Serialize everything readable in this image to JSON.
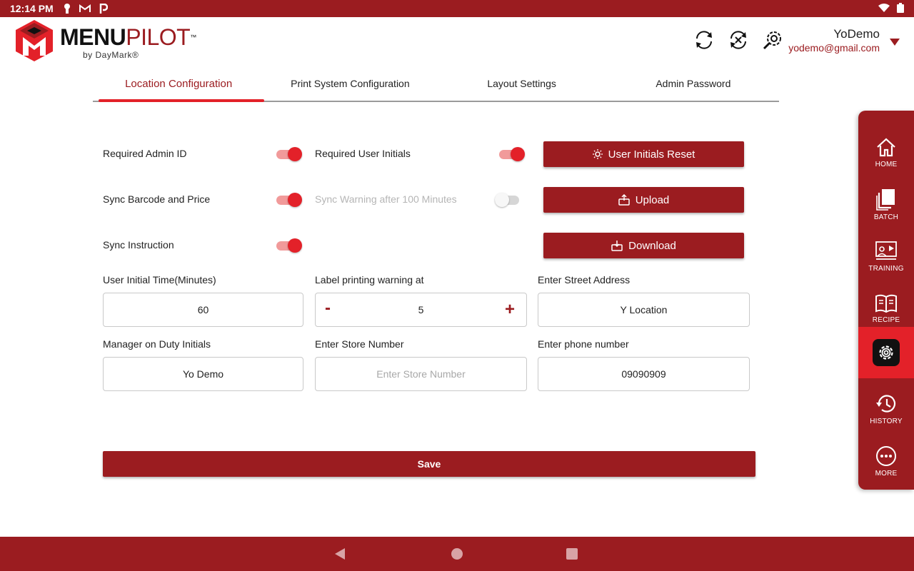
{
  "status_bar": {
    "time": "12:14 PM"
  },
  "header": {
    "brand_menu": "MENU",
    "brand_pilot": "PILOT",
    "brand_tm": "™",
    "brand_by": "by DayMark®",
    "user_name": "YoDemo",
    "user_email": "yodemo@gmail.com"
  },
  "tabs": [
    {
      "label": "Location Configuration",
      "active": true
    },
    {
      "label": "Print System Configuration",
      "active": false
    },
    {
      "label": "Layout Settings",
      "active": false
    },
    {
      "label": "Admin Password",
      "active": false
    }
  ],
  "toggles": {
    "required_admin_id": {
      "label": "Required Admin ID",
      "on": true
    },
    "required_user_initials": {
      "label": "Required User Initials",
      "on": true
    },
    "sync_barcode_price": {
      "label": "Sync Barcode and Price",
      "on": true
    },
    "sync_warning": {
      "label": "Sync Warning after 100 Minutes",
      "on": false
    },
    "sync_instruction": {
      "label": "Sync Instruction",
      "on": true
    }
  },
  "actions": {
    "user_initials_reset": "User Initials Reset",
    "upload": "Upload",
    "download": "Download"
  },
  "fields": {
    "user_initial_time": {
      "label": "User Initial Time(Minutes)",
      "value": "60"
    },
    "label_printing_warning": {
      "label": "Label printing warning at",
      "value": "5",
      "minus": "-",
      "plus": "+"
    },
    "street_address": {
      "label": "Enter Street Address",
      "value": "Y Location"
    },
    "manager_initials": {
      "label": "Manager on Duty Initials",
      "value": "Yo Demo"
    },
    "store_number": {
      "label": "Enter Store Number",
      "placeholder": "Enter Store Number"
    },
    "phone_number": {
      "label": "Enter phone number",
      "value": "09090909"
    }
  },
  "save_label": "Save",
  "sidenav": [
    {
      "label": "HOME",
      "icon": "home-icon"
    },
    {
      "label": "BATCH",
      "icon": "batch-icon"
    },
    {
      "label": "TRAINING",
      "icon": "training-icon"
    },
    {
      "label": "RECIPE",
      "icon": "recipe-icon"
    },
    {
      "label": "",
      "icon": "settings-icon",
      "active": true
    },
    {
      "label": "HISTORY",
      "icon": "history-icon"
    },
    {
      "label": "MORE",
      "icon": "more-icon"
    }
  ],
  "colors": {
    "brand": "#9b1c20",
    "accent": "#e32129"
  }
}
